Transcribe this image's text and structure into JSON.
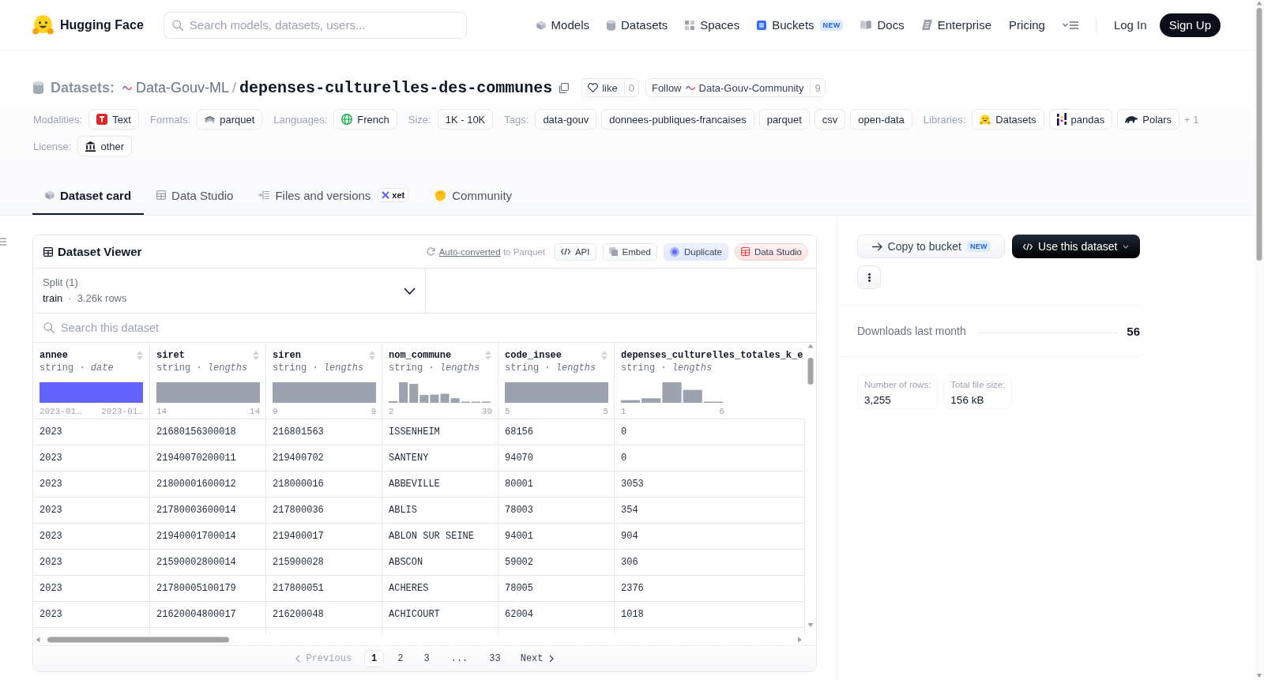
{
  "header": {
    "brand": "Hugging Face",
    "search": {
      "placeholder": "Search models, datasets, users..."
    },
    "nav": [
      {
        "label": "Models"
      },
      {
        "label": "Datasets"
      },
      {
        "label": "Spaces"
      },
      {
        "label": "Buckets",
        "badge": "NEW"
      },
      {
        "label": "Docs"
      },
      {
        "label": "Enterprise"
      },
      {
        "label": "Pricing"
      }
    ],
    "login": "Log In",
    "signup": "Sign Up"
  },
  "repo": {
    "section": "Datasets:",
    "owner": "Data-Gouv-ML",
    "separator": "/",
    "name": "depenses-culturelles-des-communes",
    "like": {
      "label": "like",
      "count": "0"
    },
    "follow": {
      "label": "Follow",
      "org": "Data-Gouv-Community",
      "count": "9"
    }
  },
  "metadata": [
    [
      {
        "label": "Modalities:",
        "chips": [
          "Text"
        ]
      },
      {
        "label": "Formats:",
        "chips": [
          "parquet"
        ]
      },
      {
        "label": "Languages:",
        "chips": [
          "French"
        ]
      },
      {
        "label": "Size:",
        "chips": [
          "1K - 10K"
        ]
      },
      {
        "label": "Tags:",
        "chips": [
          "data-gouv",
          "donnees-publiques-francaises",
          "parquet",
          "csv",
          "open-data"
        ]
      },
      {
        "label": "Libraries:",
        "chips": [
          "Datasets",
          "pandas",
          "Polars"
        ],
        "more": "+ 1"
      }
    ],
    [
      {
        "label": "License:",
        "chips": [
          "other"
        ]
      }
    ]
  ],
  "tabs": [
    {
      "label": "Dataset card",
      "selected": true
    },
    {
      "label": "Data Studio",
      "selected": false
    },
    {
      "label": "Files and versions",
      "selected": false,
      "badge": "xet"
    },
    {
      "label": "Community",
      "selected": false
    }
  ],
  "viewer": {
    "title": "Dataset Viewer",
    "conversion": {
      "link": "Auto-converted",
      "text": "to Parquet"
    },
    "actions": [
      {
        "label": "API",
        "kind": "code"
      },
      {
        "label": "Embed",
        "kind": "embed"
      },
      {
        "label": "Duplicate",
        "kind": "duplicate"
      },
      {
        "label": "Data Studio",
        "kind": "studio"
      }
    ],
    "split": {
      "label": "Split (1)",
      "name": "train",
      "separator": "·",
      "rows": "3.26k rows"
    },
    "search": {
      "placeholder": "Search this dataset"
    },
    "columns": [
      {
        "name": "annee",
        "type": "string · *date*",
        "kind": "date",
        "min": "2023-01…",
        "max": "2023-01…",
        "sort_button": true
      },
      {
        "name": "siret",
        "type": "string · *lengths*",
        "kind": "lengths",
        "min": "14",
        "max": "14",
        "sort_button": true
      },
      {
        "name": "siren",
        "type": "string · *lengths*",
        "kind": "lengths",
        "min": "9",
        "max": "9",
        "sort_button": true
      },
      {
        "name": "nom_commune",
        "type": "string · *lengths*",
        "kind": "lengths",
        "min": "2",
        "max": "30",
        "sort_button": true
      },
      {
        "name": "code_insee",
        "type": "string · *lengths*",
        "kind": "lengths",
        "min": "5",
        "max": "5",
        "sort_button": true
      },
      {
        "name": "depenses_culturelles_totales_k_e",
        "type": "string · *lengths*",
        "kind": "lengths",
        "min": "1",
        "max": "6",
        "sort_button": false
      }
    ],
    "rows": [
      [
        "2023",
        "21680156300018",
        "216801563",
        "ISSENHEIM",
        "68156",
        "0"
      ],
      [
        "2023",
        "21940070200011",
        "219400702",
        "SANTENY",
        "94070",
        "0"
      ],
      [
        "2023",
        "21800001600012",
        "218000016",
        "ABBEVILLE",
        "80001",
        "3053"
      ],
      [
        "2023",
        "21780003600014",
        "217800036",
        "ABLIS",
        "78003",
        "354"
      ],
      [
        "2023",
        "21940001700014",
        "219400017",
        "ABLON SUR SEINE",
        "94001",
        "904"
      ],
      [
        "2023",
        "21590002800014",
        "215900028",
        "ABSCON",
        "59002",
        "306"
      ],
      [
        "2023",
        "21780005100179",
        "217800051",
        "ACHERES",
        "78005",
        "2376"
      ],
      [
        "2023",
        "21620004800017",
        "216200048",
        "ACHICOURT",
        "62004",
        "1018"
      ]
    ],
    "pagination": {
      "previous": {
        "label": "Previous",
        "disabled": true
      },
      "pages": [
        {
          "label": "1",
          "kind": "page",
          "selected": true
        },
        {
          "label": "2",
          "kind": "page",
          "selected": false
        },
        {
          "label": "3",
          "kind": "page",
          "selected": false
        },
        {
          "label": "...",
          "kind": "gap",
          "selected": false
        },
        {
          "label": "33",
          "kind": "page",
          "selected": false
        }
      ],
      "next": {
        "label": "Next",
        "disabled": false
      }
    }
  },
  "sidebar": {
    "copy": {
      "label": "Copy to bucket",
      "badge": "NEW"
    },
    "use": {
      "label": "Use this dataset"
    },
    "downloads": {
      "label": "Downloads last month",
      "value": "56"
    },
    "stats": [
      {
        "label": "Number of rows:",
        "value": "3,255"
      },
      {
        "label": "Total file size:",
        "value": "156 kB"
      }
    ]
  }
}
